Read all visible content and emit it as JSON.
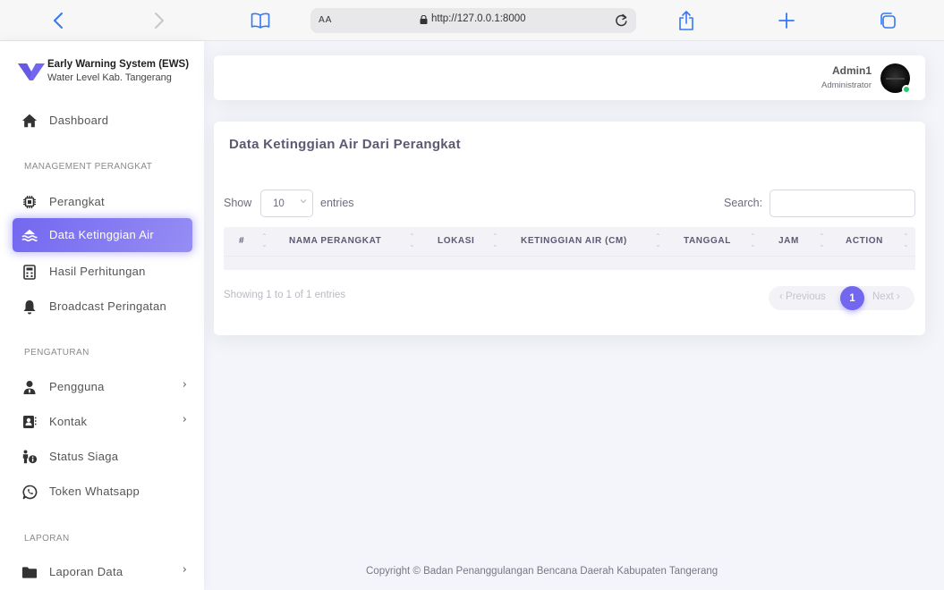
{
  "browser": {
    "aa_label": "AA",
    "url": "http://127.0.0.1:8000",
    "accent": "#3478f6"
  },
  "brand": {
    "title": "Early Warning System (EWS)",
    "subtitle": "Water Level Kab. Tangerang",
    "logo_color": "#7367f0"
  },
  "sidebar": {
    "dashboard": {
      "label": "Dashboard",
      "icon": "home-icon"
    },
    "section_perangkat": "MANAGEMENT PERANGKAT",
    "perangkat": {
      "label": "Perangkat",
      "icon": "chip-icon"
    },
    "data_ketinggian": {
      "label": "Data Ketinggian Air",
      "icon": "water-icon",
      "active": true
    },
    "hasil_perhitungan": {
      "label": "Hasil Perhitungan",
      "icon": "calculator-icon"
    },
    "broadcast": {
      "label": "Broadcast Peringatan",
      "icon": "bell-icon"
    },
    "section_pengaturan": "PENGATURAN",
    "pengguna": {
      "label": "Pengguna",
      "icon": "users-icon",
      "chevron": "›"
    },
    "kontak": {
      "label": "Kontak",
      "icon": "contact-book-icon",
      "chevron": "›"
    },
    "status_siaga": {
      "label": "Status Siaga",
      "icon": "person-info-icon"
    },
    "token_whatsapp": {
      "label": "Token Whatsapp",
      "icon": "whatsapp-icon"
    },
    "section_laporan": "LAPORAN",
    "laporan_data": {
      "label": "Laporan Data",
      "icon": "folder-icon",
      "chevron": "›"
    }
  },
  "navbar": {
    "user_name": "Admin1",
    "user_role": "Administrator",
    "status_color": "#28c76f"
  },
  "card": {
    "title": "Data Ketinggian Air Dari Perangkat",
    "show_label": "Show",
    "page_length": "10",
    "entries_label": "entries",
    "search_label": "Search:",
    "search_value": "",
    "columns": [
      "#",
      "NAMA PERANGKAT",
      "LOKASI",
      "KETINGGIAN AIR (CM)",
      "TANGGAL",
      "JAM",
      "ACTION"
    ],
    "info": "Showing 1 to 1 of 1 entries",
    "pagination": {
      "prev": "‹ Previous",
      "current": "1",
      "next": "Next ›"
    },
    "accent": "#7367f0"
  },
  "footer": {
    "text": "Copyright © Badan Penanggulangan Bencana Daerah Kabupaten Tangerang"
  }
}
